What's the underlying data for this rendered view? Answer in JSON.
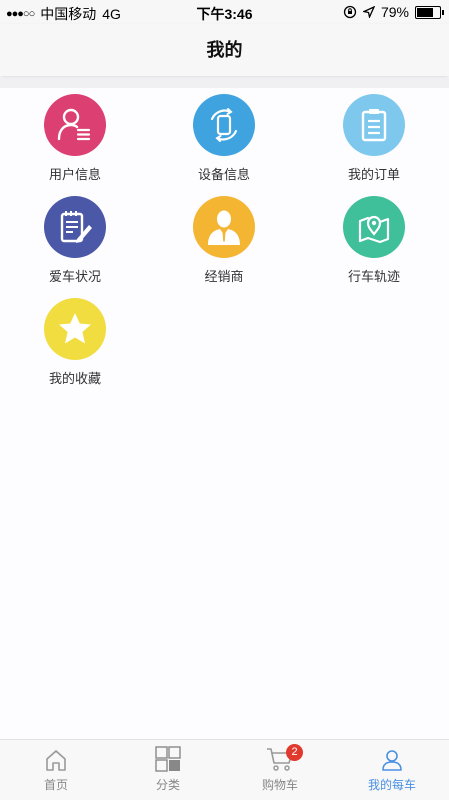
{
  "statusbar": {
    "signal": "●●●○○",
    "carrier": "中国移动",
    "network": "4G",
    "time": "下午3:46",
    "battery_percent": "79%",
    "battery_level": 0.79
  },
  "page": {
    "title": "我的"
  },
  "menu": [
    {
      "label": "用户信息",
      "icon": "user-profile-icon",
      "color": "#dc3f71"
    },
    {
      "label": "设备信息",
      "icon": "device-icon",
      "color": "#3fa3e0"
    },
    {
      "label": "我的订单",
      "icon": "clipboard-order-icon",
      "color": "#7ec8ee"
    },
    {
      "label": "爱车状况",
      "icon": "notepad-pen-icon",
      "color": "#4a58a7"
    },
    {
      "label": "经销商",
      "icon": "dealer-person-icon",
      "color": "#f3b532"
    },
    {
      "label": "行车轨迹",
      "icon": "map-pin-icon",
      "color": "#3fbf9a"
    },
    {
      "label": "我的收藏",
      "icon": "star-icon",
      "color": "#f1dd40"
    }
  ],
  "tabbar": {
    "items": [
      {
        "label": "首页",
        "icon": "home-icon"
      },
      {
        "label": "分类",
        "icon": "category-grid-icon"
      },
      {
        "label": "购物车",
        "icon": "cart-icon",
        "badge": "2"
      },
      {
        "label": "我的每车",
        "icon": "person-icon"
      }
    ],
    "active_color": "#4a90e2"
  }
}
